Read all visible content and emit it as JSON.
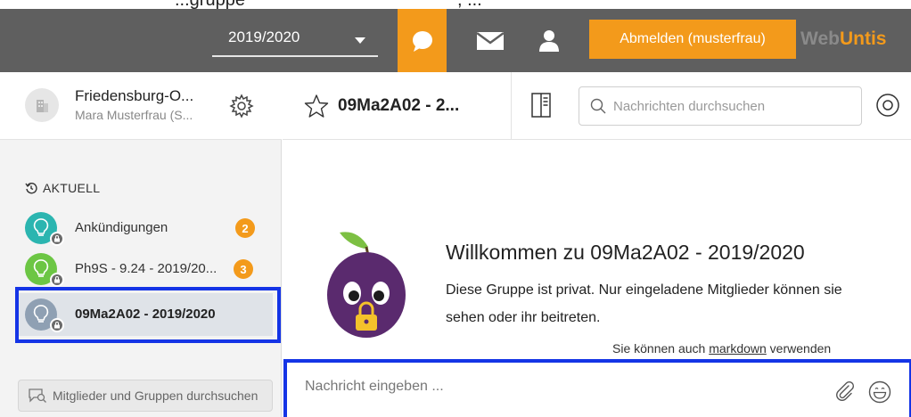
{
  "caption": {
    "left": "...gruppe",
    "right": ", ..."
  },
  "topbar": {
    "school_year": "2019/2020",
    "icons": [
      "chat-icon",
      "mail-icon",
      "user-icon"
    ],
    "logout_label": "Abmelden (musterfrau)",
    "brand_part1": "Web",
    "brand_part2": "Untis",
    "accent_color": "#f39a1b",
    "bar_color": "#5f5f5f"
  },
  "sidebar": {
    "school_name": "Friedensburg-O...",
    "user_name": "Mara Musterfrau (S...",
    "section_label": "AKTUELL",
    "channels": [
      {
        "label": "Ankündigungen",
        "badge": "2",
        "color": "#2bb5b0"
      },
      {
        "label": "Ph9S - 9.24 - 2019/20...",
        "badge": "3",
        "color": "#6cc644"
      },
      {
        "label": "09Ma2A02 - 2019/2020",
        "badge": "",
        "color": "#8fa0b3"
      }
    ],
    "member_search_placeholder": "Mitglieder und Gruppen durchsuchen"
  },
  "main": {
    "channel_title": "09Ma2A02 - 2...",
    "search_placeholder": "Nachrichten durchsuchen",
    "welcome_title": "Willkommen zu 09Ma2A02 - 2019/2020",
    "welcome_desc": "Diese Gruppe ist privat. Nur eingeladene Mitglieder können sie sehen oder ihr beitreten.",
    "markdown_hint_prefix": "Sie können auch ",
    "markdown_hint_link": "markdown",
    "markdown_hint_suffix": " verwenden",
    "composer_placeholder": "Nachricht eingeben ..."
  },
  "highlight_color": "#1434e6"
}
